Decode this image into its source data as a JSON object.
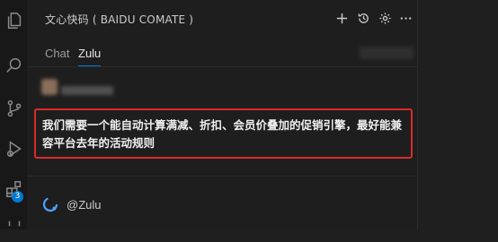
{
  "header": {
    "title": "文心快码 ( BAIDU COMATE )",
    "actions": [
      {
        "name": "new-chat",
        "glyph": "+"
      },
      {
        "name": "history",
        "glyph": "history"
      },
      {
        "name": "settings",
        "glyph": "gear"
      },
      {
        "name": "more",
        "glyph": "ellipsis"
      }
    ]
  },
  "tabs": [
    {
      "label": "Chat",
      "active": false
    },
    {
      "label": "Zulu",
      "active": true
    }
  ],
  "activity_bar": {
    "icons": [
      "explorer-icon",
      "search-icon",
      "source-control-icon",
      "run-debug-icon",
      "extensions-icon"
    ],
    "extensions_badge": "3"
  },
  "user_message": {
    "text": "我们需要一个能自动计算满减、折扣、会员价叠加的促销引擎，最好能兼容平台去年的活动规则"
  },
  "reply": {
    "name": "@Zulu"
  },
  "colors": {
    "accent": "#0078d4",
    "highlight_border": "#d92a2a"
  }
}
